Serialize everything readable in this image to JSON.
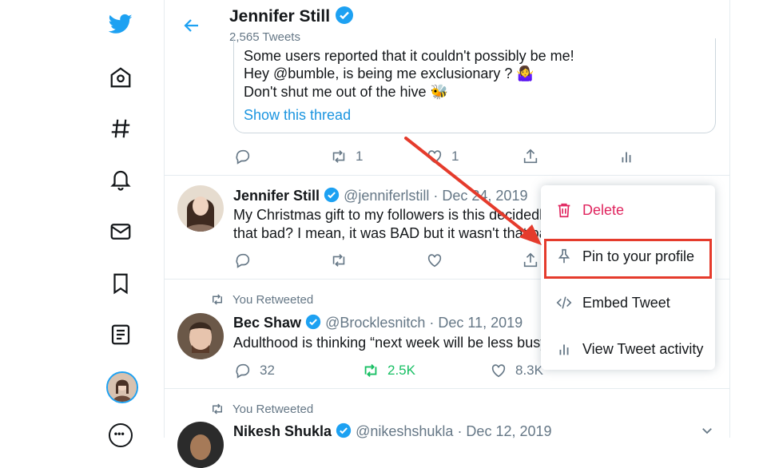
{
  "header": {
    "name": "Jennifer Still",
    "tweet_count": "2,565 Tweets"
  },
  "quoted": {
    "line1": "Some users reported that it couldn't possibly be me!",
    "line2": "Hey @bumble, is being me exclusionary ? 🤷‍♀️",
    "line3": "Don't shut me out of the hive 🐝",
    "show_thread": "Show this thread"
  },
  "tweet0": {
    "retweets": "1",
    "likes": "1"
  },
  "tweet1": {
    "name": "Jennifer Still",
    "handle": "@jenniferlstill",
    "date": "· Dec 24, 2019",
    "line1": "My Christmas gift to my followers is this decidedl",
    "line2": "that bad? I mean, it was BAD but it wasn't that ba"
  },
  "tweet2": {
    "context": "You Retweeted",
    "name": "Bec Shaw",
    "handle": "@Brocklesnitch",
    "date": "· Dec 11, 2019",
    "text": "Adulthood is thinking “next week will be less busy",
    "replies": "32",
    "retweets": "2.5K",
    "likes": "8.3K"
  },
  "tweet3": {
    "context": "You Retweeted",
    "name": "Nikesh Shukla",
    "handle": "@nikeshshukla",
    "date": "· Dec 12, 2019"
  },
  "menu": {
    "delete": "Delete",
    "pin": "Pin to your profile",
    "embed": "Embed Tweet",
    "activity": "View Tweet activity"
  },
  "colors": {
    "accent": "#1da1f2",
    "delete": "#e0245e",
    "highlight": "#e53b2c",
    "retweet_active": "#17bf63"
  }
}
